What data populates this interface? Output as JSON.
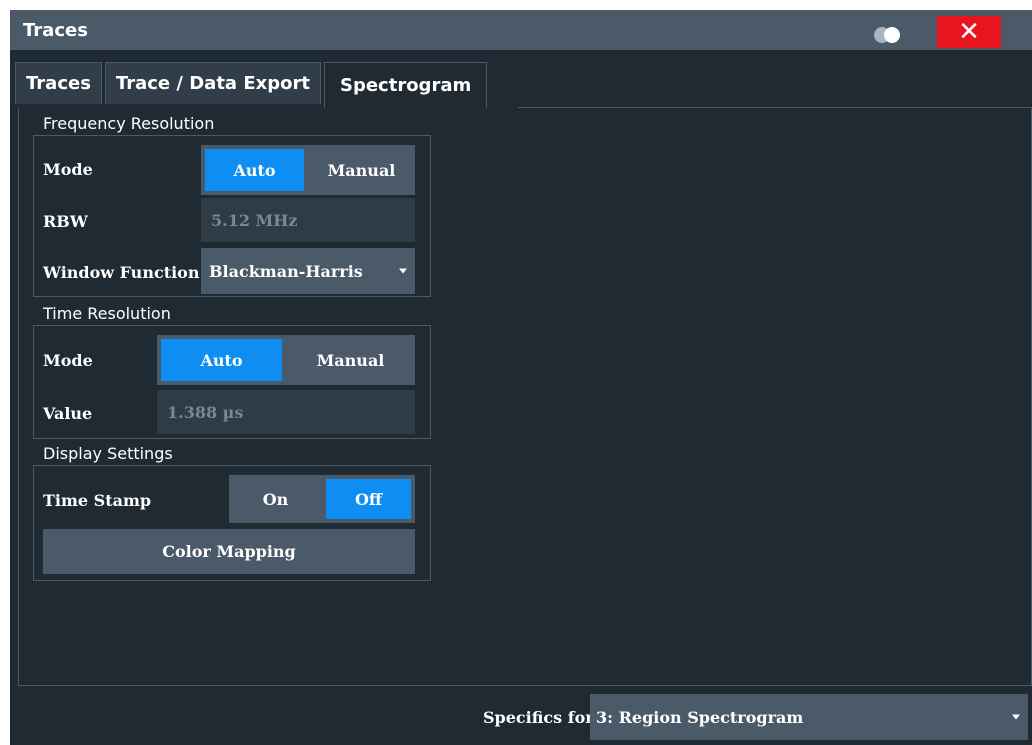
{
  "window": {
    "title": "Traces"
  },
  "tabs": [
    {
      "label": "Traces"
    },
    {
      "label": "Trace / Data Export"
    },
    {
      "label": "Spectrogram"
    }
  ],
  "frequency_resolution": {
    "title": "Frequency Resolution",
    "mode_label": "Mode",
    "mode_options": [
      "Auto",
      "Manual"
    ],
    "mode_selected": "Auto",
    "rbw_label": "RBW",
    "rbw_value": "5.12 MHz",
    "window_function_label": "Window Function",
    "window_function_value": "Blackman-Harris"
  },
  "time_resolution": {
    "title": "Time Resolution",
    "mode_label": "Mode",
    "mode_options": [
      "Auto",
      "Manual"
    ],
    "mode_selected": "Auto",
    "value_label": "Value",
    "value": "1.388 µs"
  },
  "display_settings": {
    "title": "Display Settings",
    "time_stamp_label": "Time Stamp",
    "time_stamp_options": [
      "On",
      "Off"
    ],
    "time_stamp_selected": "Off",
    "color_mapping_label": "Color Mapping"
  },
  "footer": {
    "specifics_label": "Specifics for",
    "specifics_value": "3: Region Spectrogram"
  },
  "colors": {
    "accent": "#0e8ef2",
    "close": "#e8141e",
    "background": "#1f2a33",
    "control": "#4a5a68"
  },
  "icons": {
    "title_toggle": "toggle-transparency-icon",
    "close": "close-icon",
    "dropdown": "chevron-down-icon"
  }
}
